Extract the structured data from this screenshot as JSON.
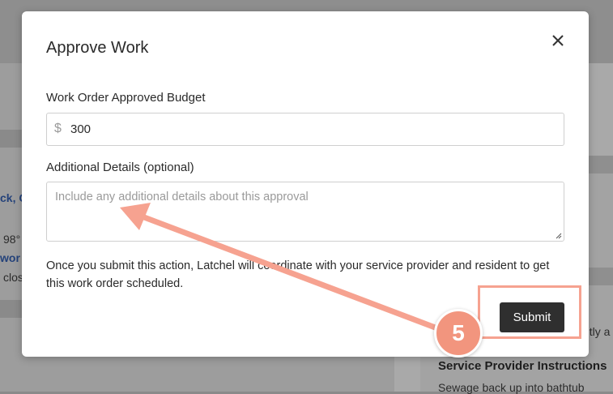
{
  "background": {
    "fragments": [
      "ck, C",
      "98°",
      "wor",
      "clos",
      "ntly a",
      "Service Provider Instructions",
      "Sewage back up into bathtub"
    ]
  },
  "modal": {
    "title": "Approve Work",
    "close_icon": "close-icon",
    "budget": {
      "label": "Work Order Approved Budget",
      "currency_symbol": "$",
      "value": "300"
    },
    "details": {
      "label": "Additional Details (optional)",
      "placeholder": "Include any additional details about this approval",
      "value": ""
    },
    "info_text": "Once you submit this action, Latchel will coordinate with your service provider and resident to get this work order scheduled.",
    "submit_label": "Submit"
  },
  "annotation": {
    "step_number": "5",
    "color": "#f6a290"
  }
}
